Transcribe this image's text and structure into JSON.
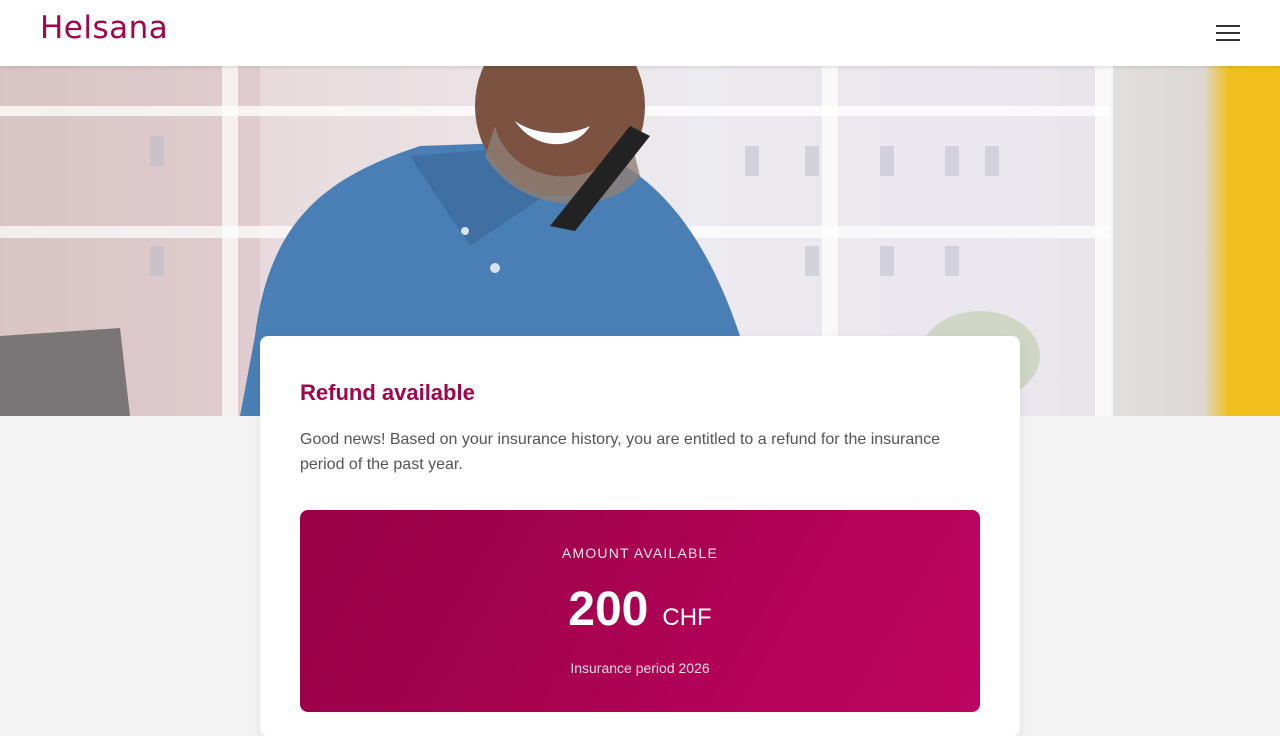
{
  "header": {
    "logo_text": "Helsana",
    "menu_icon": "hamburger-menu-icon"
  },
  "hero": {
    "image_description_icon": "hero-photo"
  },
  "refund_card": {
    "title": "Refund available",
    "text": "Good news! Based on your insurance history, you are entitled to a refund for the insurance period of the past year.",
    "amount": {
      "label": "AMOUNT AVAILABLE",
      "value": "200",
      "currency": "CHF",
      "period": "Insurance period 2026"
    }
  },
  "colors": {
    "brand": "#a0064a",
    "amount_box_start": "#9a0048",
    "amount_box_end": "#bd0560",
    "accent_yellow": "#f2bf1c"
  }
}
